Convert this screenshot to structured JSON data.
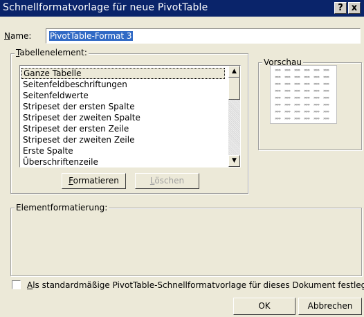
{
  "window": {
    "title": "Schnellformatvorlage für neue PivotTable",
    "help_glyph": "?",
    "close_glyph": "x"
  },
  "name": {
    "label_prefix": "N",
    "label_rest": "ame:",
    "value": "PivotTable-Format 3"
  },
  "table_element": {
    "legend_prefix": "T",
    "legend_rest": "abellenelement:",
    "items": [
      "Ganze Tabelle",
      "Seitenfeldbeschriftungen",
      "Seitenfeldwerte",
      "Stripeset der ersten Spalte",
      "Stripeset der zweiten Spalte",
      "Stripeset der ersten Zeile",
      "Stripeset der zweiten Zeile",
      "Erste Spalte",
      "Überschriftenzeile"
    ],
    "selected_index": 0,
    "format_button_prefix": "F",
    "format_button_rest": "ormatieren",
    "delete_button_prefix": "L",
    "delete_button_rest": "öschen"
  },
  "preview": {
    "legend": "Vorschau",
    "cell_glyph": "»»»"
  },
  "element_formatting": {
    "legend": "Elementformatierung:"
  },
  "default_checkbox": {
    "checked": false,
    "label_prefix": "A",
    "label_rest": "ls standardmäßige PivotTable-Schnellformatvorlage für dieses Dokument festlegen"
  },
  "footer": {
    "ok_label": "OK",
    "cancel_label": "Abbrechen"
  },
  "icons": {
    "scroll_up": "up-arrow-icon",
    "scroll_down": "down-arrow-icon"
  }
}
